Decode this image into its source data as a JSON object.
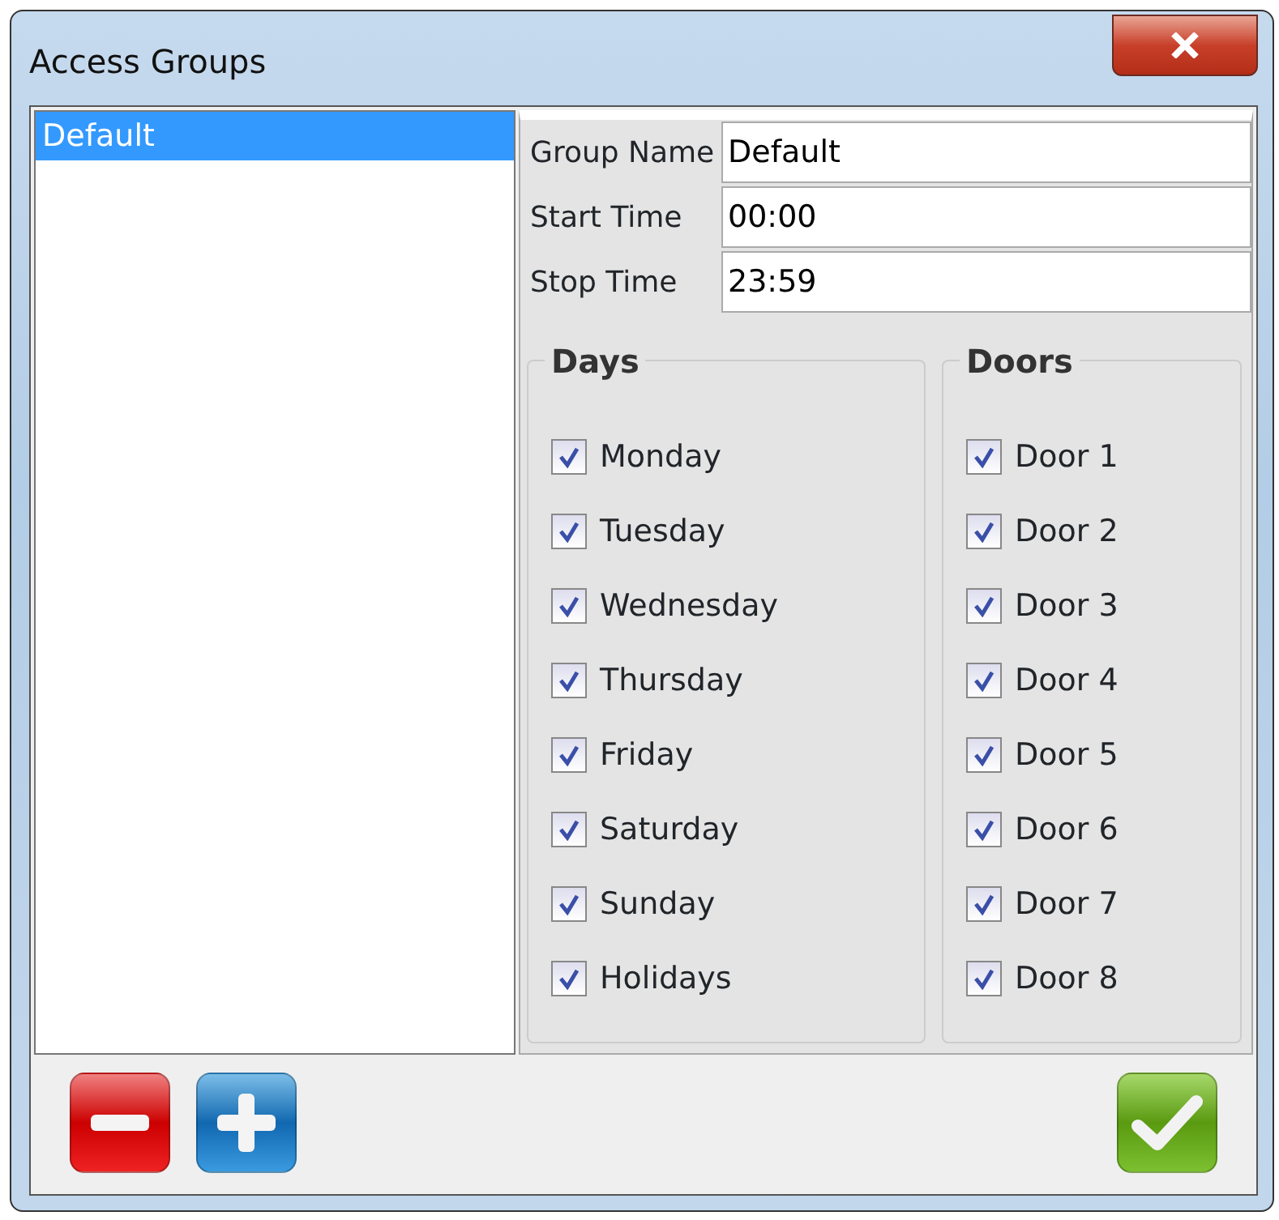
{
  "window": {
    "title": "Access Groups"
  },
  "groups": [
    {
      "label": "Default",
      "selected": true
    }
  ],
  "fields": [
    {
      "label": "Group Name",
      "value": "Default"
    },
    {
      "label": "Start Time",
      "value": "00:00"
    },
    {
      "label": "Stop Time",
      "value": "23:59"
    }
  ],
  "days": {
    "title": "Days",
    "items": [
      {
        "label": "Monday",
        "checked": true
      },
      {
        "label": "Tuesday",
        "checked": true
      },
      {
        "label": "Wednesday",
        "checked": true
      },
      {
        "label": "Thursday",
        "checked": true
      },
      {
        "label": "Friday",
        "checked": true
      },
      {
        "label": "Saturday",
        "checked": true
      },
      {
        "label": "Sunday",
        "checked": true
      },
      {
        "label": "Holidays",
        "checked": true
      }
    ]
  },
  "doors": {
    "title": "Doors",
    "items": [
      {
        "label": "Door 1",
        "checked": true
      },
      {
        "label": "Door 2",
        "checked": true
      },
      {
        "label": "Door 3",
        "checked": true
      },
      {
        "label": "Door 4",
        "checked": true
      },
      {
        "label": "Door 5",
        "checked": true
      },
      {
        "label": "Door 6",
        "checked": true
      },
      {
        "label": "Door 7",
        "checked": true
      },
      {
        "label": "Door 8",
        "checked": true
      }
    ]
  }
}
